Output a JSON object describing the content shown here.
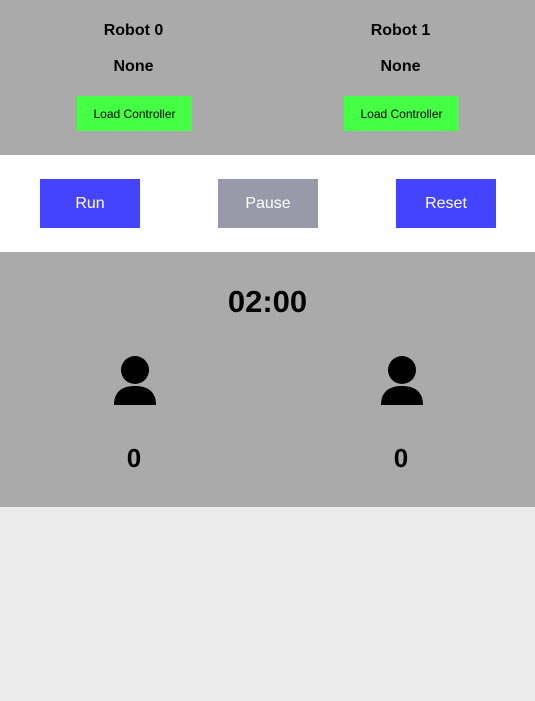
{
  "robots": [
    {
      "name": "Robot 0",
      "controller": "None",
      "load_label": "Load Controller",
      "score": "0"
    },
    {
      "name": "Robot 1",
      "controller": "None",
      "load_label": "Load Controller",
      "score": "0"
    }
  ],
  "controls": {
    "run_label": "Run",
    "pause_label": "Pause",
    "reset_label": "Reset"
  },
  "timer": "02:00",
  "icons": {
    "avatar": "person-icon"
  },
  "colors": {
    "load_button": "#44ff44",
    "primary_button": "#4444ff",
    "disabled_button": "#9999aa",
    "panel_background": "#aaaaaa"
  }
}
